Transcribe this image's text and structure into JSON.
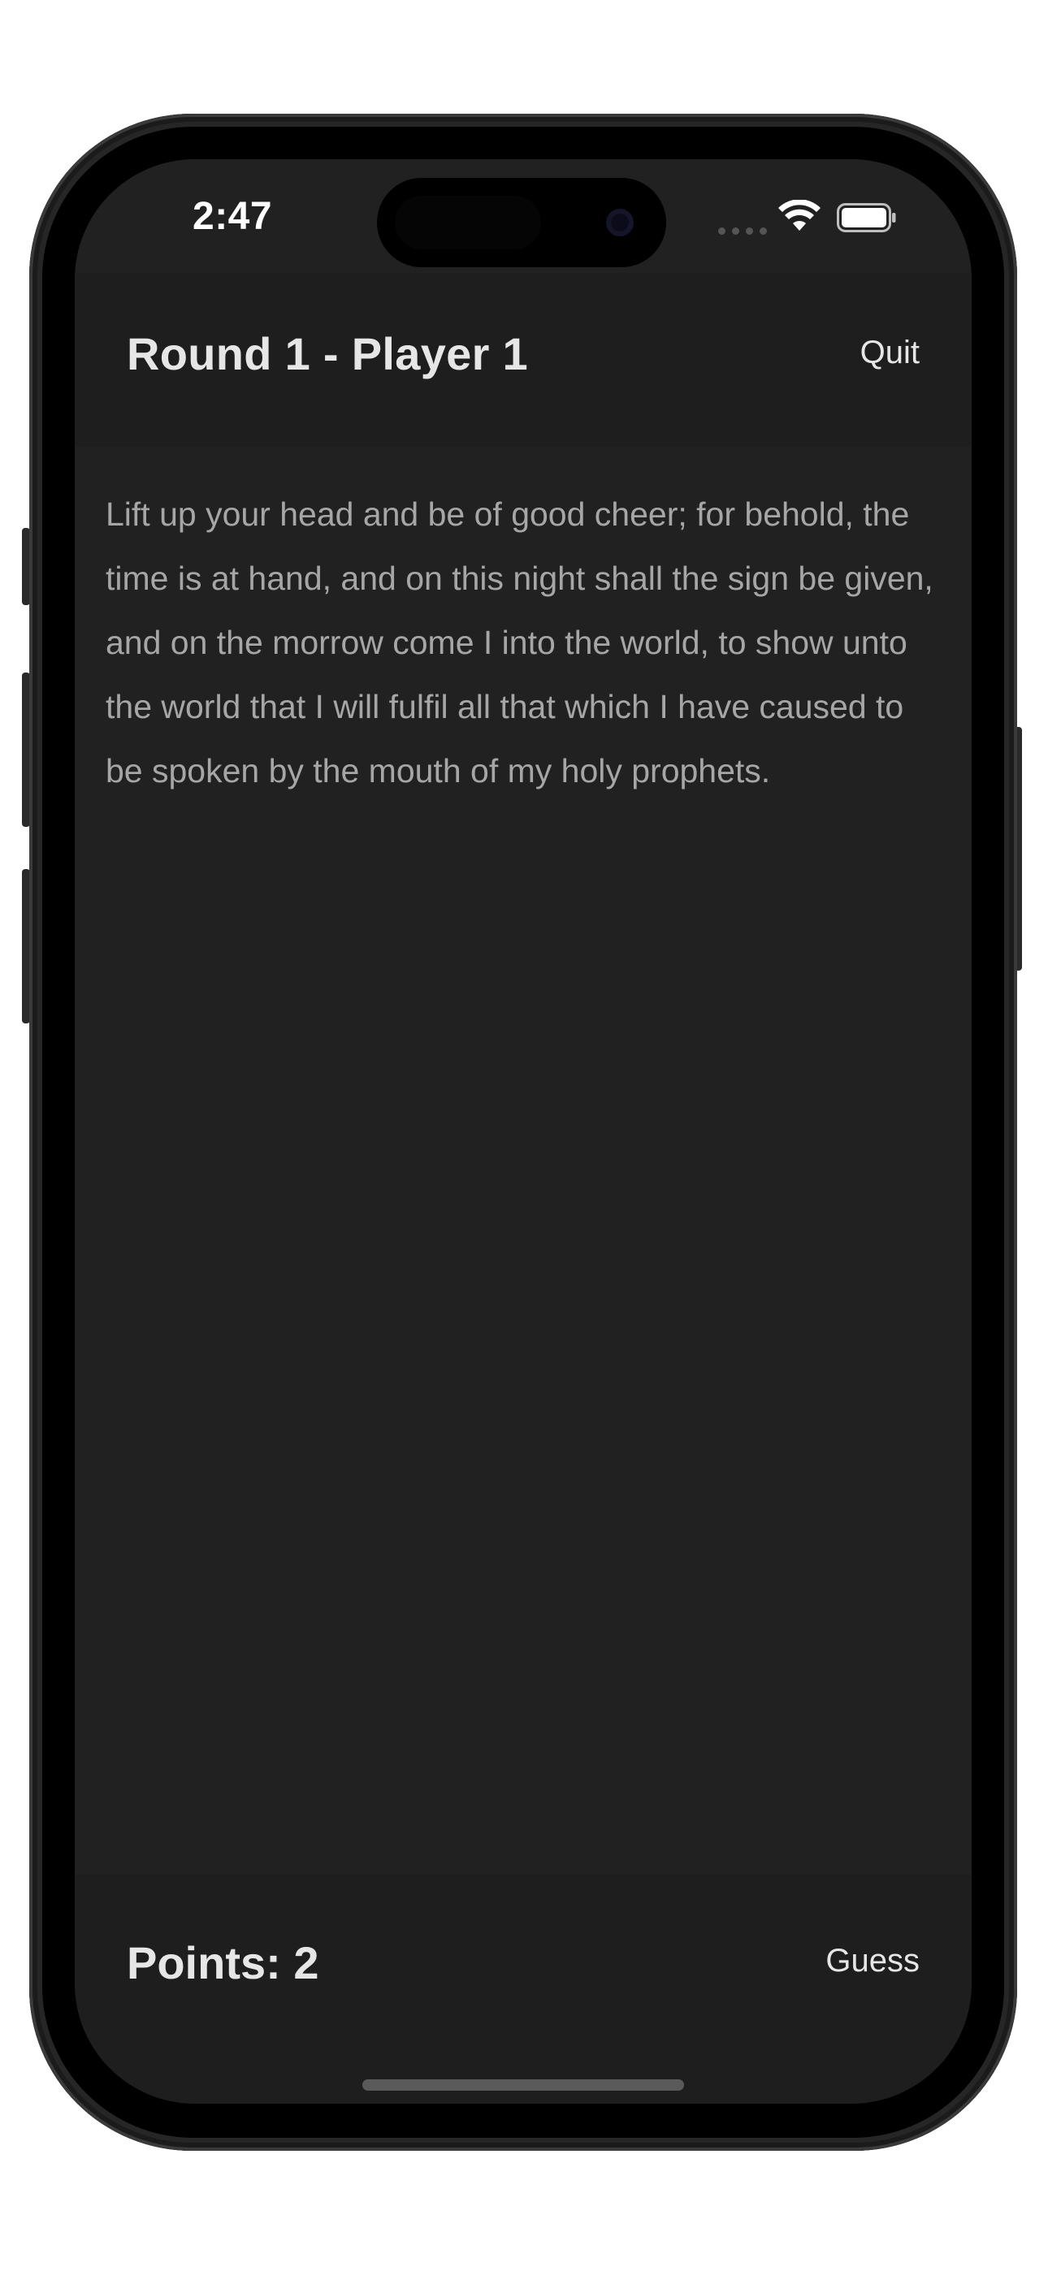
{
  "status_bar": {
    "time": "2:47",
    "wifi_icon": "wifi-icon",
    "battery_icon": "battery-icon",
    "signal_icon": "cellular-signal-icon"
  },
  "header": {
    "title": "Round 1 - Player 1",
    "quit_label": "Quit"
  },
  "verse": {
    "text": "Lift up your head and be of good cheer; for behold, the time is at hand, and on this night shall the sign be given, and on the morrow come I into the world, to show unto the world that I will fulfil all that which I have caused to be spoken by the mouth of my holy prophets."
  },
  "footer": {
    "points_label": "Points: 2",
    "guess_label": "Guess"
  },
  "colors": {
    "screen_background": "#212121",
    "bar_background": "#1e1e1e",
    "primary_text": "#e6e6e6",
    "secondary_text": "#a6a6a6"
  }
}
